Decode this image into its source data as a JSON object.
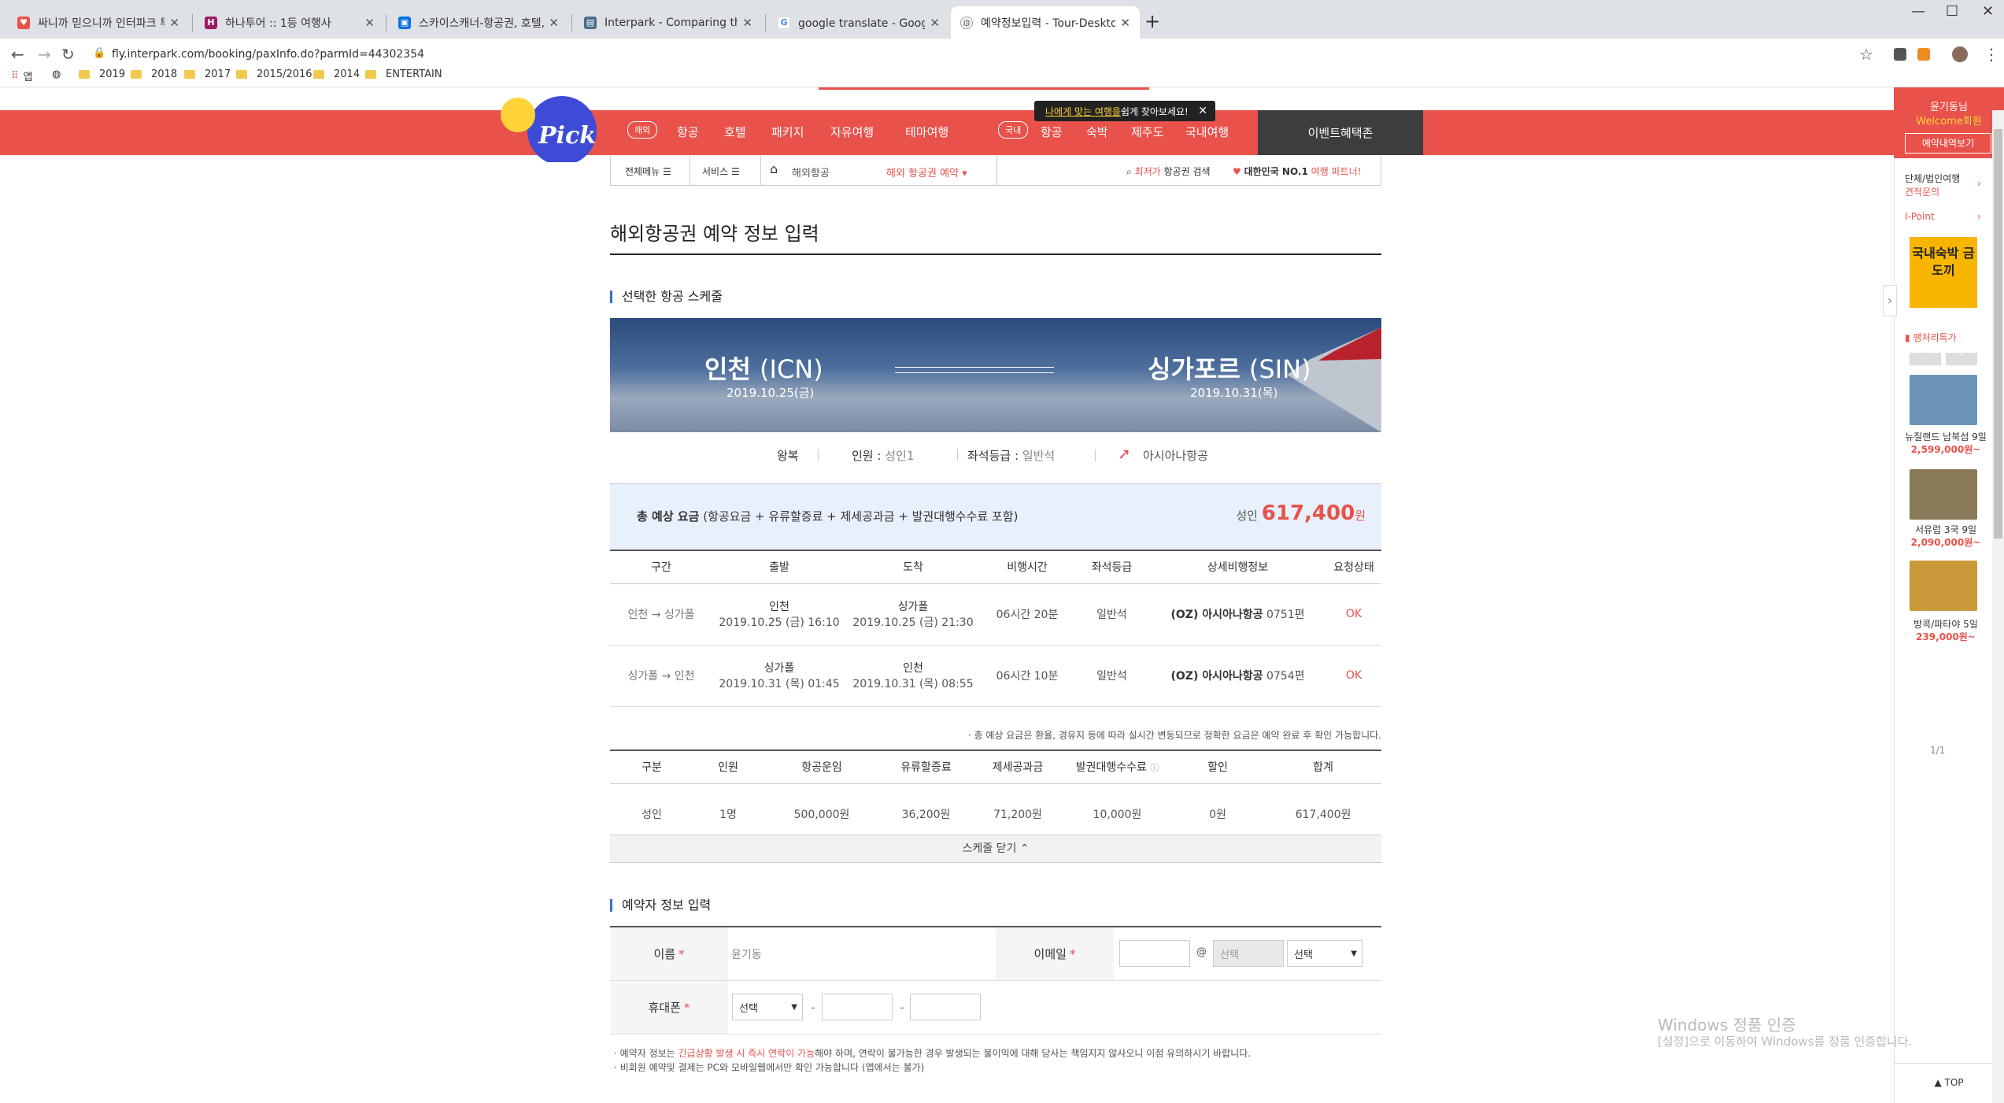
{
  "browser": {
    "tabs": [
      {
        "title": "싸니까 믿으니까 인터파크 투어",
        "favicon_color": "#e8524b"
      },
      {
        "title": "하나투어 :: 1등 여행사",
        "favicon_color": "#9b1b6b"
      },
      {
        "title": "스카이스캐너-항공권, 호텔, 렌트",
        "favicon_color": "#0770e3"
      },
      {
        "title": "Interpark - Comparing the figu",
        "favicon_color": "#4a6d8c"
      },
      {
        "title": "google translate - Google 검색",
        "favicon_color": "#4285f4"
      },
      {
        "title": "예약정보입력 - Tour-Desktop",
        "favicon_color": "#666666"
      }
    ],
    "active_tab": 5,
    "url": "fly.interpark.com/booking/paxInfo.do?parmId=44302354",
    "bookmarks": [
      "앱",
      "2019",
      "2018",
      "2017",
      "2015/2016",
      "2014",
      "ENTERTAIN"
    ]
  },
  "site": {
    "tooltip": {
      "pre": "나에게 맞는 여행을",
      "post": " 쉽게 찾아보세요!"
    },
    "overseas_pill": "해외",
    "domestic_pill": "국내",
    "menu_overseas": [
      "항공",
      "호텔",
      "패키지",
      "자유여행",
      "테마여행"
    ],
    "menu_domestic": [
      "항공",
      "숙박",
      "제주도",
      "국내여행"
    ],
    "event_zone": "이벤트혜택존",
    "subnav": {
      "all_menu": "전체메뉴",
      "service": "서비스",
      "crumb1": "해외항공",
      "crumb2": "해외 항공권 예약",
      "lowest": "최저가",
      "lowest_rest": "항공권 검색",
      "no1": "대한민국 NO.1",
      "partner": "여행 파트너!"
    },
    "brand_accent": "#e8524b"
  },
  "page": {
    "title": "해외항공권 예약 정보 입력",
    "schedule_heading": "선택한 항공 스케줄",
    "origin_city": "인천",
    "origin_code": "(ICN)",
    "origin_date": "2019.10.25(금)",
    "dest_city": "싱가포르",
    "dest_code": "(SIN)",
    "dest_date": "2019.10.31(목)",
    "trip_type": "왕복",
    "passengers_label": "인원 :",
    "passengers": "성인1",
    "seat_label": "좌석등급 :",
    "seat": "일반석",
    "airline": "아시아나항공",
    "fare_label": "총 예상 요금",
    "fare_detail": "(항공요금 + 유류할증료 + 제세공과금 + 발권대행수수료 포함)",
    "fare_pax": "성인",
    "fare_amount": "617,400",
    "fare_unit": "원",
    "flights_headers": [
      "구간",
      "출발",
      "도착",
      "비행시간",
      "좌석등급",
      "상세비행정보",
      "요청상태"
    ],
    "flights": [
      {
        "seg": "인천 → 싱가폴",
        "dep_city": "인천",
        "dep_time": "2019.10.25 (금) 16:10",
        "arr_city": "싱가폴",
        "arr_time": "2019.10.25 (금) 21:30",
        "duration": "06시간 20분",
        "seat": "일반석",
        "airline": "(OZ) 아시아나항공",
        "flight": "0751편",
        "status": "OK"
      },
      {
        "seg": "싱가폴 → 인천",
        "dep_city": "싱가폴",
        "dep_time": "2019.10.31 (목) 01:45",
        "arr_city": "인천",
        "arr_time": "2019.10.31 (목) 08:55",
        "duration": "06시간 10분",
        "seat": "일반석",
        "airline": "(OZ) 아시아나항공",
        "flight": "0754편",
        "status": "OK"
      }
    ],
    "fare_note": "· 총 예상 요금은 환율, 경유지 등에 따라 실시간 변동되므로 정확한 요금은 예약 완료 후 확인 가능합니다.",
    "price_headers": [
      "구분",
      "인원",
      "항공운임",
      "유류할증료",
      "제세공과금",
      "발권대행수수료",
      "할인",
      "합계"
    ],
    "price_row": [
      "성인",
      "1명",
      "500,000원",
      "36,200원",
      "71,200원",
      "10,000원",
      "0원",
      "617,400원"
    ],
    "close_schedule": "스케줄 닫기 ⌃",
    "booker_heading": "예약자 정보 입력",
    "name_label": "이름",
    "name_value": "윤기동",
    "email_label": "이메일",
    "email_at": "@",
    "email_domain_placeholder": "선택",
    "email_select": "선택",
    "phone_label": "휴대폰",
    "phone_select": "선택",
    "dash": "-",
    "note_a_pre": "· 예약자 정보는 ",
    "note_a_red": "긴급상황 발생 시 즉시 연락이 가능",
    "note_a_post": "해야 하며, 연락이 불가능한 경우 발생되는 불이익에 대해 당사는 책임지지 않사오니 이점 유의하시기 바랍니다.",
    "note_b": "· 비회원 예약및 결제는 PC와 모바일웹에서만 확인 가능합니다 (앱에서는 불가)"
  },
  "side": {
    "user": "윤기동님",
    "welcome": "Welcome회원",
    "mybook": "예약내역보기",
    "corp1": "단체/법인여행",
    "corp2": "견적문의",
    "ipoint": "I-Point",
    "promo": "국내숙박 금도끼",
    "special": "땡처리특가",
    "items": [
      {
        "caption": "뉴질랜드 남북섬 9일",
        "price": "2,599,000원~",
        "color": "#6b93b8"
      },
      {
        "caption": "서유럽 3국 9일",
        "price": "2,090,000원~",
        "color": "#8a7a5a"
      },
      {
        "caption": "방콕/파타야 5일",
        "price": "239,000원~",
        "color": "#c99a3a"
      }
    ],
    "page": "1/1",
    "top": "TOP"
  },
  "windows_watermark": {
    "line1": "Windows 정품 인증",
    "line2": "[설정]으로 이동하여 Windows를 정품 인증합니다."
  }
}
